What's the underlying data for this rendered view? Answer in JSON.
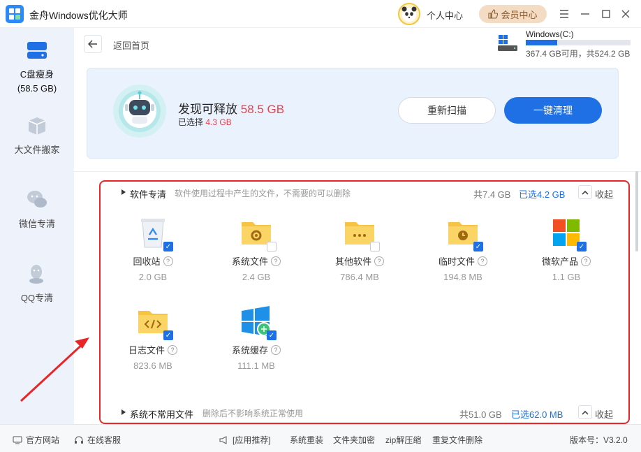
{
  "app": {
    "title": "金舟Windows优化大师"
  },
  "header": {
    "user_center": "个人中心",
    "vip_label": "会员中心",
    "controls": [
      "menu-icon",
      "minimize-icon",
      "maximize-icon",
      "close-icon"
    ]
  },
  "sidebar": {
    "items": [
      {
        "label": "C盘瘦身",
        "sub": "(58.5 GB)",
        "icon": "disk-icon",
        "active": true
      },
      {
        "label": "大文件搬家",
        "icon": "box-icon"
      },
      {
        "label": "微信专清",
        "icon": "wechat-icon"
      },
      {
        "label": "QQ专清",
        "icon": "qq-icon"
      }
    ]
  },
  "nav": {
    "back_label": "返回首页"
  },
  "drive": {
    "name": "Windows(C:)",
    "info": "367.4 GB可用，共524.2 GB",
    "used_fraction": 0.3
  },
  "hero": {
    "found_prefix": "发现可释放",
    "found_value": "58.5 GB",
    "selected_prefix": "已选择",
    "selected_value": "4.3 GB",
    "rescan_label": "重新扫描",
    "clean_label": "一键清理"
  },
  "sections": [
    {
      "title": "软件专清",
      "desc": "软件使用过程中产生的文件，不需要的可以删除",
      "total": "共7.4 GB",
      "selected": "已选4.2 GB",
      "collapse": "收起",
      "items": [
        {
          "name": "回收站",
          "size": "2.0 GB",
          "checked": true,
          "icon": "recycle-bin-icon"
        },
        {
          "name": "系统文件",
          "size": "2.4 GB",
          "checked": false,
          "icon": "gear-folder-icon"
        },
        {
          "name": "其他软件",
          "size": "786.4 MB",
          "checked": false,
          "icon": "dots-folder-icon"
        },
        {
          "name": "临时文件",
          "size": "194.8 MB",
          "checked": true,
          "icon": "clock-folder-icon"
        },
        {
          "name": "微软产品",
          "size": "1.1 GB",
          "checked": true,
          "icon": "microsoft-icon"
        },
        {
          "name": "日志文件",
          "size": "823.6 MB",
          "checked": true,
          "icon": "code-folder-icon"
        },
        {
          "name": "系统缓存",
          "size": "111.1 MB",
          "checked": true,
          "icon": "windows-cache-icon"
        }
      ]
    },
    {
      "title": "系统不常用文件",
      "desc": "删除后不影响系统正常使用",
      "total": "共51.0 GB",
      "selected": "已选62.0 MB",
      "collapse": "收起"
    }
  ],
  "footer": {
    "website": "官方网站",
    "service": "在线客服",
    "recommend": "[应用推荐]",
    "links": [
      "系统重装",
      "文件夹加密",
      "zip解压缩",
      "重复文件删除"
    ],
    "version": "版本号：V3.2.0"
  },
  "colors": {
    "accent": "#1f6fe5",
    "highlight_red": "#e8424b",
    "annotation_red": "#e8262a"
  }
}
